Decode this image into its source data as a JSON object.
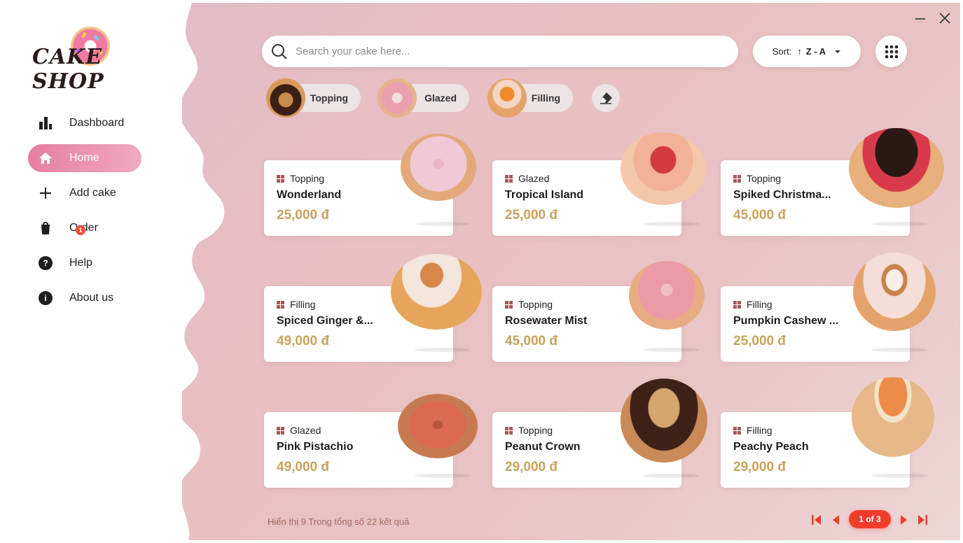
{
  "brand": {
    "logo_text": "CAKE SHOP"
  },
  "window": {
    "minimize_label": "—",
    "close_label": "✕"
  },
  "sidebar": {
    "items": [
      {
        "label": "Dashboard",
        "icon": "bar-chart-icon",
        "active": false
      },
      {
        "label": "Home",
        "icon": "home-icon",
        "active": true
      },
      {
        "label": "Add cake",
        "icon": "plus-icon",
        "active": false
      },
      {
        "label": "Order",
        "icon": "order-icon",
        "active": false,
        "badge": "1"
      },
      {
        "label": "Help",
        "icon": "help-icon",
        "active": false
      },
      {
        "label": "About us",
        "icon": "info-icon",
        "active": false
      }
    ]
  },
  "search": {
    "placeholder": "Search your cake here...",
    "value": ""
  },
  "sort": {
    "label": "Sort:",
    "arrow": "↑",
    "value": "Z - A"
  },
  "filters": [
    {
      "label": "Topping"
    },
    {
      "label": "Glazed"
    },
    {
      "label": "Filling"
    }
  ],
  "products": [
    {
      "category": "Topping",
      "name": "Wonderland",
      "price": "25,000 đ"
    },
    {
      "category": "Glazed",
      "name": "Tropical Island",
      "price": "25,000 đ"
    },
    {
      "category": "Topping",
      "name": "Spiked Christma...",
      "price": "45,000 đ"
    },
    {
      "category": "Filling",
      "name": "Spiced Ginger &...",
      "price": "49,000 đ"
    },
    {
      "category": "Topping",
      "name": "Rosewater Mist",
      "price": "45,000 đ"
    },
    {
      "category": "Filling",
      "name": "Pumpkin Cashew ...",
      "price": "25,000 đ"
    },
    {
      "category": "Glazed",
      "name": "Pink Pistachio",
      "price": "49,000 đ"
    },
    {
      "category": "Topping",
      "name": "Peanut Crown",
      "price": "29,000 đ"
    },
    {
      "category": "Filling",
      "name": "Peachy Peach",
      "price": "29,000 đ"
    }
  ],
  "footer": {
    "summary": "Hiển thị 9 Trong tổng số 22 kết quả"
  },
  "pagination": {
    "current_label": "1 of 3"
  },
  "colors": {
    "accent": "#e67ea2",
    "price": "#c9a35c",
    "pager": "#f03c2a"
  }
}
